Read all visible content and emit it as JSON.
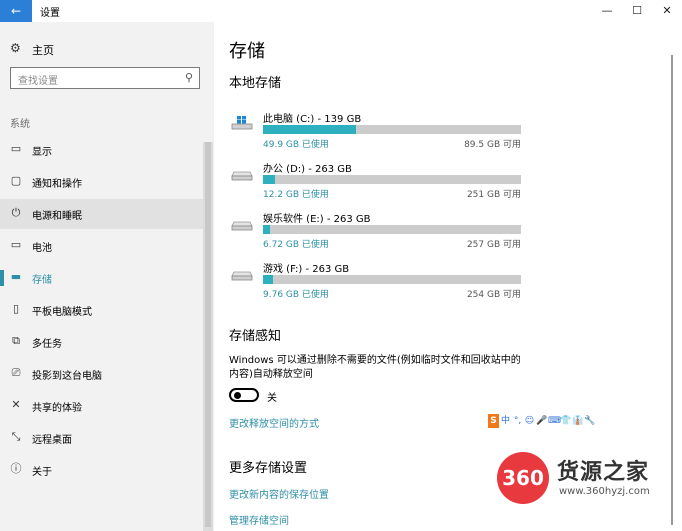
{
  "window": {
    "back_icon": "back-arrow-icon",
    "title": "设置",
    "controls": [
      "—",
      "☐",
      "✕"
    ]
  },
  "sidebar": {
    "home_label": "主页",
    "search_placeholder": "查找设置",
    "group_label": "系统",
    "items": [
      {
        "label": "显示",
        "icon": "display-icon"
      },
      {
        "label": "通知和操作",
        "icon": "notification-icon"
      },
      {
        "label": "电源和睡眠",
        "icon": "power-icon",
        "state": "hover"
      },
      {
        "label": "电池",
        "icon": "battery-icon"
      },
      {
        "label": "存储",
        "icon": "storage-icon",
        "state": "active"
      },
      {
        "label": "平板电脑模式",
        "icon": "tablet-icon"
      },
      {
        "label": "多任务",
        "icon": "multitask-icon"
      },
      {
        "label": "投影到这台电脑",
        "icon": "project-icon"
      },
      {
        "label": "共享的体验",
        "icon": "share-icon"
      },
      {
        "label": "远程桌面",
        "icon": "remote-icon"
      },
      {
        "label": "关于",
        "icon": "info-icon"
      }
    ]
  },
  "main": {
    "page_title": "存储",
    "local_storage_title": "本地存储",
    "drives": [
      {
        "name": "此电脑 (C:) - 139 GB",
        "used": "49.9 GB 已使用",
        "free": "89.5 GB 可用",
        "used_fraction": 0.36,
        "icon": "windows-drive-icon"
      },
      {
        "name": "办公 (D:) - 263 GB",
        "used": "12.2 GB 已使用",
        "free": "251 GB 可用",
        "used_fraction": 0.046,
        "icon": "drive-icon"
      },
      {
        "name": "娱乐软件 (E:) - 263 GB",
        "used": "6.72 GB 已使用",
        "free": "257 GB 可用",
        "used_fraction": 0.026,
        "icon": "drive-icon"
      },
      {
        "name": "游戏 (F:) - 263 GB",
        "used": "9.76 GB 已使用",
        "free": "254 GB 可用",
        "used_fraction": 0.037,
        "icon": "drive-icon"
      }
    ],
    "storage_sense_title": "存储感知",
    "storage_sense_desc": "Windows 可以通过删除不需要的文件(例如临时文件和回收站中的内容)自动释放空间",
    "toggle_label": "关",
    "toggle_on": false,
    "change_free_link": "更改释放空间的方式",
    "more_settings_title": "更多存储设置",
    "change_save_link": "更改新内容的保存位置",
    "manage_link": "管理存储空间"
  },
  "overlay": {
    "ime_items": [
      "S",
      "中",
      "°,",
      "☺",
      "🎤",
      "⌨",
      "👕",
      "👔",
      "🔧"
    ],
    "watermark_logo": "360",
    "watermark_name": "货源之家",
    "watermark_url": "www.360hyzj.com"
  },
  "colors": {
    "accent": "#2e8fa6",
    "bar_fill": "#2eb0be",
    "bar_track": "#cccccc",
    "sidebar_bg": "#f2f2f2",
    "back_button": "#2b7fd6"
  }
}
